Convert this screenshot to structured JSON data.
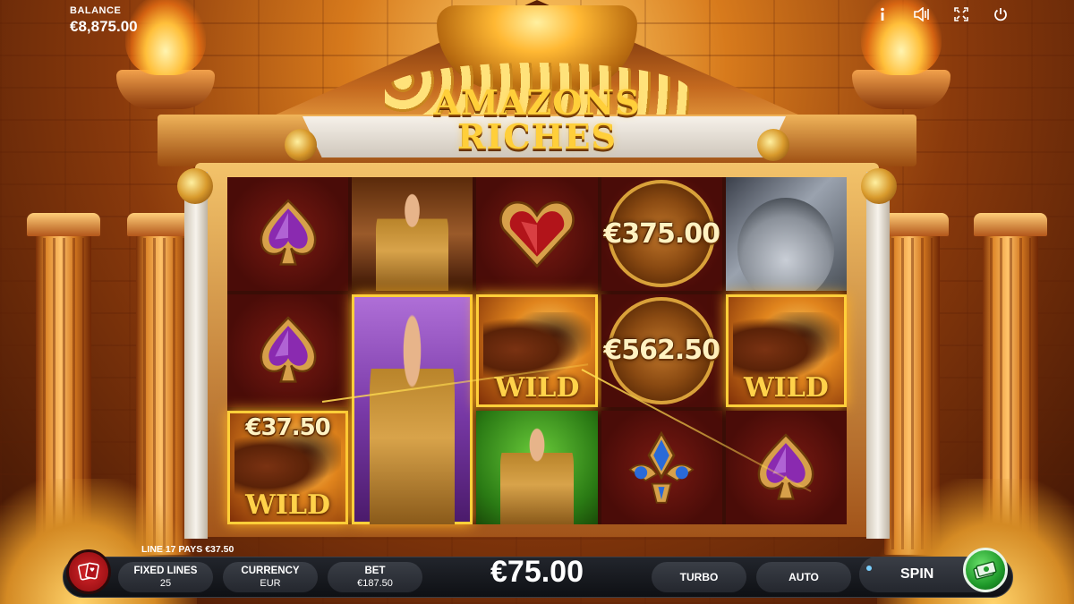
{
  "game": {
    "logo_line1": "AMAZONS",
    "logo_line2": "RICHES"
  },
  "hud": {
    "balance_label": "BALANCE",
    "balance_value": "€8,875.00",
    "icons": [
      "info-icon",
      "sound-icon",
      "fullscreen-icon",
      "power-icon"
    ]
  },
  "reels": {
    "values": {
      "r1_wild": "€37.50",
      "r4_coin1": "€375.00",
      "r4_coin2": "€562.50"
    },
    "wild_label": "WILD"
  },
  "controls": {
    "line_pays": "LINE 17 PAYS €37.50",
    "fixed_lines_label": "FIXED LINES",
    "fixed_lines_value": "25",
    "currency_label": "CURRENCY",
    "currency_value": "EUR",
    "bet_label": "BET",
    "bet_value": "€187.50",
    "win_amount": "€75.00",
    "turbo_label": "TURBO",
    "auto_label": "AUTO",
    "spin_label": "SPIN"
  },
  "colors": {
    "accent_gold": "#ffcf3a",
    "menu_red": "#d7262a",
    "spin_green": "#1f9a2a"
  }
}
